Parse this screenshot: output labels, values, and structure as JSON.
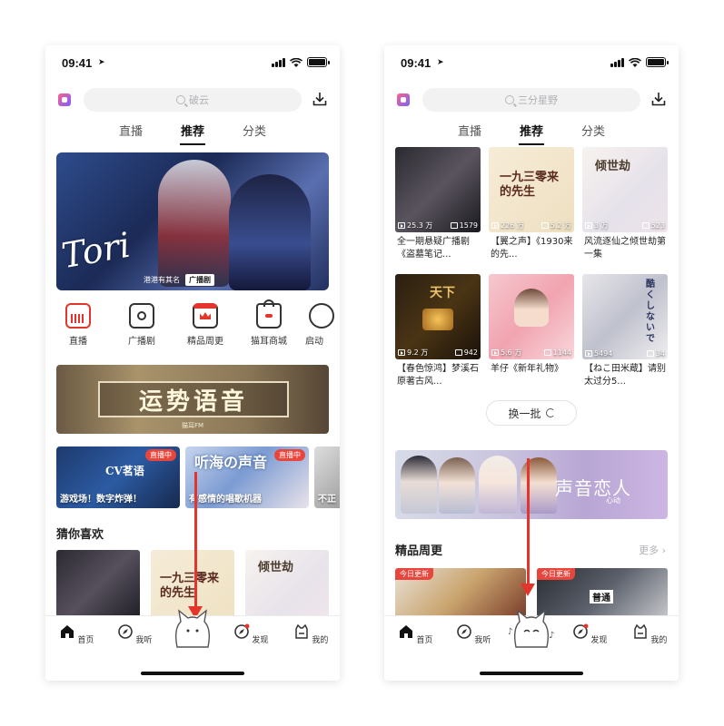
{
  "colors": {
    "accent_red": "#e3352b",
    "live_badge": "#e8453c",
    "text_dark": "#222222",
    "muted": "#b0b0b4"
  },
  "status": {
    "time": "09:41"
  },
  "left": {
    "search_placeholder": "破云",
    "tabs": [
      "直播",
      "推荐",
      "分类"
    ],
    "active_tab": "推荐",
    "banner": {
      "art_text": "Tori",
      "caption_main": "港港有其名",
      "caption_tag": "广播剧"
    },
    "quick_links": [
      {
        "label": "直播",
        "icon": "live-icon"
      },
      {
        "label": "广播剧",
        "icon": "radio-icon"
      },
      {
        "label": "精品周更",
        "icon": "calendar-crown-icon"
      },
      {
        "label": "猫耳商城",
        "icon": "shop-bag-icon"
      },
      {
        "label": "启动",
        "icon": "ticket-icon"
      }
    ],
    "promo": {
      "title": "运势语音",
      "sub": "猫耳FM"
    },
    "live_cards": [
      {
        "title": "游戏场！数字炸弹！",
        "badge": "直播中",
        "art": "CV茗语"
      },
      {
        "title": "有感情的唱歌机器",
        "badge": "直播中",
        "art": "听海の声音"
      },
      {
        "title": "不正",
        "badge": ""
      }
    ],
    "section_title": "猜你喜欢"
  },
  "right": {
    "search_placeholder": "三分星野",
    "tabs": [
      "直播",
      "推荐",
      "分类"
    ],
    "active_tab": "推荐",
    "grid": [
      {
        "plays": "25.3 万",
        "eps": "1579",
        "caption": "全一期悬疑广播剧《盗墓笔记..."
      },
      {
        "plays": "226 万",
        "eps": "5.2 万",
        "caption": "【翼之声】《1930来的先...",
        "art": "一九三零来的先生"
      },
      {
        "plays": "3 万",
        "eps": "523",
        "caption": "风流逐仙之倾世劫第一集",
        "art": "倾世劫"
      },
      {
        "plays": "9.2 万",
        "eps": "942",
        "caption": "【春色惊鸿】梦溪石原著古风...",
        "art": "天下"
      },
      {
        "plays": "5.6 万",
        "eps": "1144",
        "caption": "羊仔《新年礼物》"
      },
      {
        "plays": "5494",
        "eps": "34",
        "caption": "【ねこ田米蔵】请别太过分5...",
        "art": "酷くしないで"
      }
    ],
    "refresh_label": "换一批",
    "romance_banner": {
      "title": "声音恋人",
      "sub": "心动"
    },
    "section_title": "精品周更",
    "more_label": "更多",
    "today_badge": "今日更新",
    "weekly_art": "普通"
  },
  "tab_bar": [
    {
      "label": "首页",
      "icon": "home-icon"
    },
    {
      "label": "我听",
      "icon": "compass-icon"
    },
    {
      "label": "",
      "icon": "cat-mascot-icon"
    },
    {
      "label": "发现",
      "icon": "discover-icon"
    },
    {
      "label": "我的",
      "icon": "profile-cat-icon"
    }
  ]
}
